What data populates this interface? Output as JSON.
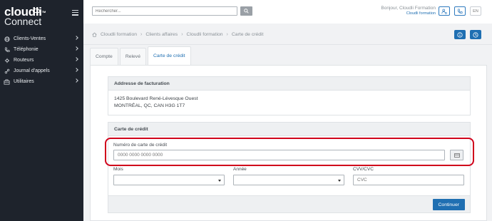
{
  "brand": {
    "name": "cloudli",
    "tm": "TM",
    "product": "Connect"
  },
  "sidebar": {
    "items": [
      {
        "label": "Clients-Ventes",
        "icon": "globe-icon"
      },
      {
        "label": "Téléphonie",
        "icon": "phone-icon"
      },
      {
        "label": "Routeurs",
        "icon": "router-icon"
      },
      {
        "label": "Journal d'appels",
        "icon": "call-log-icon"
      },
      {
        "label": "Utilitaires",
        "icon": "briefcase-icon"
      }
    ]
  },
  "topbar": {
    "search_placeholder": "Rechercher...",
    "greeting": "Bonjour, Cloudli Formation",
    "account": "Cloudli formation",
    "lang": "EN"
  },
  "breadcrumb": [
    "Cloudli formation",
    "Clients affaires",
    "Cloudli formation",
    "Carte de crédit"
  ],
  "tabs": [
    {
      "label": "Compte",
      "active": false
    },
    {
      "label": "Relevé",
      "active": false
    },
    {
      "label": "Carte de crédit",
      "active": true
    }
  ],
  "billing": {
    "title": "Addresse de facturation",
    "line1": "1425 Boulevard René-Lévesque Ouest",
    "line2": "MONTRÉAL, QC, CAN H3G 1T7"
  },
  "card": {
    "title": "Carte de crédit",
    "number_label": "Numéro de carte de crédit",
    "number_placeholder": "0000 0000 0000 0000",
    "month_label": "Mois",
    "year_label": "Année",
    "cvv_label": "CVV/CVC",
    "cvv_placeholder": "CVC",
    "continue_label": "Continuer"
  },
  "colors": {
    "accent": "#1f6fb2",
    "highlight": "#d0021b",
    "sidebar": "#1e232c"
  }
}
